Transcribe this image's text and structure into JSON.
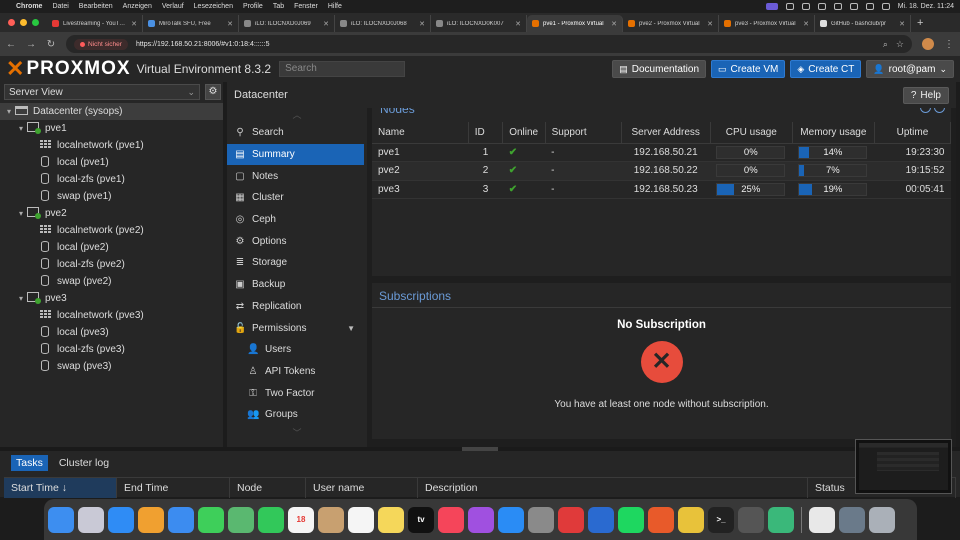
{
  "menubar": {
    "apple": "",
    "items": [
      "Chrome",
      "Datei",
      "Bearbeiten",
      "Anzeigen",
      "Verlauf",
      "Lesezeichen",
      "Profile",
      "Tab",
      "Fenster",
      "Hilfe"
    ],
    "clock": "Mi. 18. Dez.  11:24"
  },
  "browser": {
    "tabs": [
      {
        "label": "Livestreaming - YouTube",
        "favicon_color": "#e53935"
      },
      {
        "label": "MiroTalk SFU, Free",
        "favicon_color": "#4a90e2"
      },
      {
        "label": "iLO: ILOCNXD0J069",
        "favicon_color": "#888888"
      },
      {
        "label": "iLO: ILOCNXD0J068",
        "favicon_color": "#888888"
      },
      {
        "label": "iLO: ILOCNXD0K007",
        "favicon_color": "#888888"
      },
      {
        "label": "pve1 - Proxmox Virtual",
        "favicon_color": "#e57000",
        "active": true
      },
      {
        "label": "pve2 - Proxmox Virtual",
        "favicon_color": "#e57000"
      },
      {
        "label": "pve3 - Proxmox Virtual",
        "favicon_color": "#e57000"
      },
      {
        "label": "GitHub - bashclub/pr",
        "favicon_color": "#dddddd"
      }
    ],
    "new_tab": "+",
    "insecure_label": "Nicht sicher",
    "url": "https://192.168.50.21:8006/#v1:0:18:4::::::5"
  },
  "header": {
    "logo_x": "✕",
    "logo_text": "PROXMOX",
    "version": "Virtual Environment 8.3.2",
    "search_placeholder": "Search",
    "documentation": "Documentation",
    "create_vm": "Create VM",
    "create_ct": "Create CT",
    "user": "root@pam"
  },
  "tree": {
    "view": "Server View",
    "items": [
      {
        "label": "Datacenter (sysops)",
        "type": "datacenter",
        "depth": 0,
        "selected": true
      },
      {
        "label": "pve1",
        "type": "node",
        "depth": 1
      },
      {
        "label": "localnetwork (pve1)",
        "type": "network",
        "depth": 2
      },
      {
        "label": "local (pve1)",
        "type": "storage",
        "depth": 2
      },
      {
        "label": "local-zfs (pve1)",
        "type": "storage",
        "depth": 2
      },
      {
        "label": "swap (pve1)",
        "type": "storage",
        "depth": 2
      },
      {
        "label": "pve2",
        "type": "node",
        "depth": 1
      },
      {
        "label": "localnetwork (pve2)",
        "type": "network",
        "depth": 2
      },
      {
        "label": "local (pve2)",
        "type": "storage",
        "depth": 2
      },
      {
        "label": "local-zfs (pve2)",
        "type": "storage",
        "depth": 2
      },
      {
        "label": "swap (pve2)",
        "type": "storage",
        "depth": 2
      },
      {
        "label": "pve3",
        "type": "node",
        "depth": 1
      },
      {
        "label": "localnetwork (pve3)",
        "type": "network",
        "depth": 2
      },
      {
        "label": "local (pve3)",
        "type": "storage",
        "depth": 2
      },
      {
        "label": "local-zfs (pve3)",
        "type": "storage",
        "depth": 2
      },
      {
        "label": "swap (pve3)",
        "type": "storage-alt",
        "depth": 2
      }
    ]
  },
  "content": {
    "breadcrumb": "Datacenter",
    "help": "Help",
    "subnav": [
      {
        "label": "Search",
        "icon": "search-icon",
        "glyph": "⚲"
      },
      {
        "label": "Summary",
        "icon": "book-icon",
        "glyph": "▤",
        "active": true
      },
      {
        "label": "Notes",
        "icon": "notes-icon",
        "glyph": "▢"
      },
      {
        "label": "Cluster",
        "icon": "server-icon",
        "glyph": "▦"
      },
      {
        "label": "Ceph",
        "icon": "ceph-icon",
        "glyph": "◎"
      },
      {
        "label": "Options",
        "icon": "gear-icon",
        "glyph": "⚙"
      },
      {
        "label": "Storage",
        "icon": "database-icon",
        "glyph": "≣"
      },
      {
        "label": "Backup",
        "icon": "floppy-icon",
        "glyph": "▣"
      },
      {
        "label": "Replication",
        "icon": "retweet-icon",
        "glyph": "⇄"
      },
      {
        "label": "Permissions",
        "icon": "unlock-icon",
        "glyph": "🔓",
        "expandable": true
      },
      {
        "label": "Users",
        "icon": "user-icon",
        "glyph": "👤",
        "sub": true
      },
      {
        "label": "API Tokens",
        "icon": "user-outline-icon",
        "glyph": "♙",
        "sub": true
      },
      {
        "label": "Two Factor",
        "icon": "key-icon",
        "glyph": "⚿",
        "sub": true
      },
      {
        "label": "Groups",
        "icon": "users-icon",
        "glyph": "👥",
        "sub": true
      }
    ],
    "nodes_title": "Nodes",
    "nodes_columns": [
      "Name",
      "ID",
      "Online",
      "Support",
      "Server Address",
      "CPU usage",
      "Memory usage",
      "Uptime"
    ],
    "nodes": [
      {
        "name": "pve1",
        "id": "1",
        "online": "✔",
        "support": "-",
        "address": "192.168.50.21",
        "cpu": 0,
        "cpu_label": "0%",
        "mem": 14,
        "mem_label": "14%",
        "uptime": "19:23:30"
      },
      {
        "name": "pve2",
        "id": "2",
        "online": "✔",
        "support": "-",
        "address": "192.168.50.22",
        "cpu": 0,
        "cpu_label": "0%",
        "mem": 7,
        "mem_label": "7%",
        "uptime": "19:15:52"
      },
      {
        "name": "pve3",
        "id": "3",
        "online": "✔",
        "support": "-",
        "address": "192.168.50.23",
        "cpu": 25,
        "cpu_label": "25%",
        "mem": 19,
        "mem_label": "19%",
        "uptime": "00:05:41"
      }
    ],
    "subscriptions_title": "Subscriptions",
    "no_subscription": "No Subscription",
    "no_subscription_msg": "You have at least one node without subscription."
  },
  "tasks": {
    "tabs": [
      "Tasks",
      "Cluster log"
    ],
    "columns": [
      {
        "label": "Start Time ↓",
        "sorted": true
      },
      {
        "label": "End Time"
      },
      {
        "label": "Node"
      },
      {
        "label": "User name"
      },
      {
        "label": "Description"
      },
      {
        "label": "Status"
      }
    ]
  },
  "dock": {
    "apps": [
      {
        "name": "finder",
        "color": "#3d8ef0"
      },
      {
        "name": "launchpad",
        "color": "#c9c9d6"
      },
      {
        "name": "safari",
        "color": "#2f8cf5"
      },
      {
        "name": "photos",
        "color": "#f0a030"
      },
      {
        "name": "mail",
        "color": "#3c8cf0"
      },
      {
        "name": "messages",
        "color": "#3ecf5a"
      },
      {
        "name": "maps",
        "color": "#5ab870"
      },
      {
        "name": "facetime",
        "color": "#32c85a"
      },
      {
        "name": "calendar",
        "color": "#f5f5f5",
        "text": "18",
        "text_color": "#e53935"
      },
      {
        "name": "contacts",
        "color": "#c8a070"
      },
      {
        "name": "reminders",
        "color": "#f5f5f5"
      },
      {
        "name": "notes",
        "color": "#f5d75a"
      },
      {
        "name": "appletv",
        "color": "#111111",
        "text": "tv"
      },
      {
        "name": "music",
        "color": "#f5455a"
      },
      {
        "name": "podcasts",
        "color": "#a050e0"
      },
      {
        "name": "appstore",
        "color": "#2a8cf5"
      },
      {
        "name": "settings",
        "color": "#8a8a8a"
      },
      {
        "name": "vpn",
        "color": "#e03a3a"
      },
      {
        "name": "proxyman",
        "color": "#2a6ad0"
      },
      {
        "name": "spotify",
        "color": "#1ed760"
      },
      {
        "name": "antivirus",
        "color": "#e85a2a"
      },
      {
        "name": "chrome",
        "color": "#e8c23a"
      },
      {
        "name": "terminal",
        "color": "#222222",
        "text": ">_"
      },
      {
        "name": "calculator",
        "color": "#555555"
      },
      {
        "name": "sync",
        "color": "#3ab87a"
      }
    ],
    "right": [
      {
        "name": "document",
        "color": "#e8e8e8"
      },
      {
        "name": "downloads",
        "color": "#6a7a8a"
      },
      {
        "name": "trash",
        "color": "#aab0b8"
      }
    ]
  }
}
